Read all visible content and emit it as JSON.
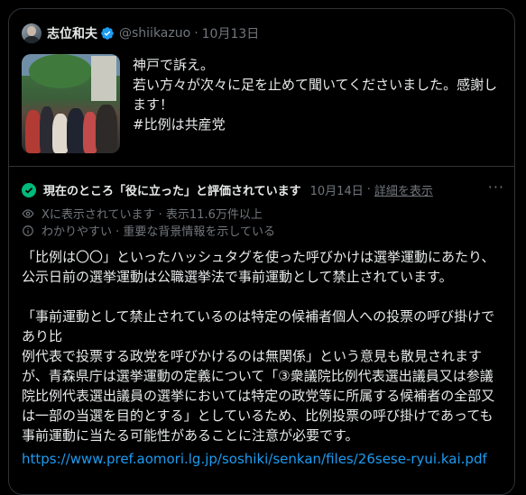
{
  "tweet": {
    "author": "志位和夫",
    "handle": "@shiikazuo",
    "separator": "·",
    "date": "10月13日",
    "text_lines": [
      "神戸で訴え。",
      "若い方々が次々に足を止めて聞いてくださいました。感謝し",
      "ます！",
      "#比例は共産党"
    ]
  },
  "note": {
    "title": "現在のところ「役に立った」と評価されています",
    "date": "10月14日",
    "separator": "·",
    "details_link": "詳細を表示",
    "more": "···",
    "shown_on_x": "Xに表示されています · 表示11.6万件以上",
    "reason": "わかりやすい · 重要な背景情報を示している",
    "paragraph1": [
      "「比例は〇〇」といったハッシュタグを使った呼びかけは選挙運動にあたり、",
      "公示日前の選挙運動は公職選挙法で事前運動として禁止されています。"
    ],
    "paragraph2": [
      "「事前運動として禁止されているのは特定の候補者個人への投票の呼び掛けであり比",
      "例代表で投票する政党を呼びかけるのは無関係」という意見も散見されます",
      "が、青森県庁は選挙運動の定義について「③衆議院比例代表選出議員又は参議",
      "院比例代表選出議員の選挙においては特定の政党等に所属する候補者の全部又",
      "は一部の当選を目的とする」としているため、比例投票の呼び掛けであっても",
      "事前運動に当たる可能性があることに注意が必要です。"
    ],
    "url": "https://www.pref.aomori.lg.jp/soshiki/senkan/files/26sese-ryui.kai.pdf"
  },
  "colors": {
    "background": "#000000",
    "text": "#e7e9ea",
    "muted": "#71767b",
    "border": "#2f3336",
    "link": "#1d9bf0",
    "verified": "#1d9bf0",
    "helpful": "#00ba7c"
  },
  "icons": [
    "avatar",
    "verified-badge-icon",
    "check-circle-icon",
    "eye-icon",
    "info-icon",
    "more-icon"
  ]
}
